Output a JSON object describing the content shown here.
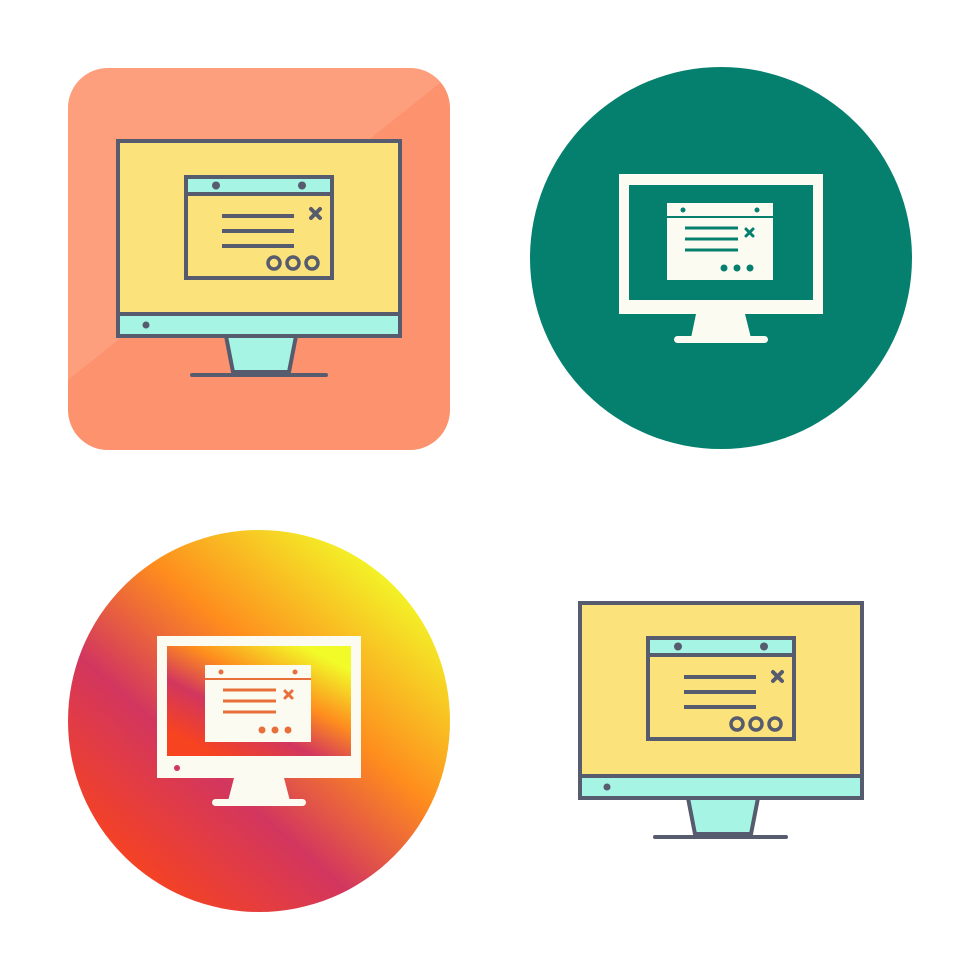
{
  "colors": {
    "outline": "#575b6e",
    "screen_yellow": "#fbe27a",
    "teal_light": "#a6f4e4",
    "orange_square": "#fc926e",
    "orange_square_highlight": "#fda98a",
    "green_circle": "#06806e",
    "white_glyph": "#fbfbf2",
    "gradient_stops": [
      "#f7431f",
      "#d2365f",
      "#fe8c1e",
      "#f2fa28"
    ]
  },
  "icons": [
    {
      "name": "monitor-popup-square-icon",
      "style": "filled-outline",
      "background": "rounded-square"
    },
    {
      "name": "monitor-popup-glyph-circle-icon",
      "style": "glyph",
      "background": "circle"
    },
    {
      "name": "monitor-popup-gradient-circle-icon",
      "style": "glyph",
      "background": "gradient-circle"
    },
    {
      "name": "monitor-popup-plain-icon",
      "style": "filled-outline",
      "background": "none"
    }
  ]
}
